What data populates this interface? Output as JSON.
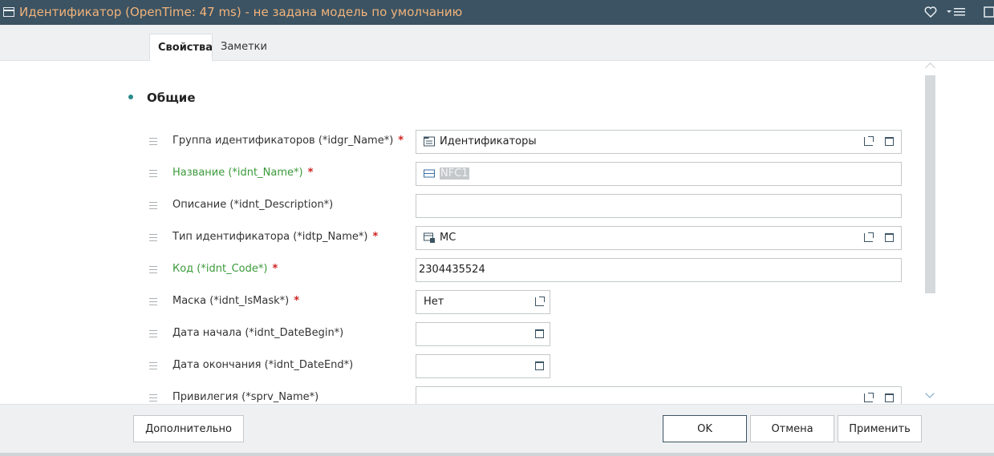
{
  "window": {
    "title": "Идентификатор (OpenTime: 47 ms) - не задана модель по умолчанию"
  },
  "tabs": [
    {
      "label": "Свойства",
      "active": true
    },
    {
      "label": "Заметки",
      "active": false
    }
  ],
  "section": {
    "title": "Общие"
  },
  "fields": [
    {
      "label": "Группа идентификаторов (*idgr_Name*)",
      "required": "*",
      "value": "Идентификаторы",
      "icon": "folder-list-icon"
    },
    {
      "label": "Название (*idnt_Name*)",
      "required": "*",
      "value": "NFC1",
      "icon": "text-field-icon"
    },
    {
      "label": "Описание (*idnt_Description*)",
      "value": ""
    },
    {
      "label": "Тип идентификатора (*idtp_Name*)",
      "required": "*",
      "value": "MC",
      "icon": "lock-list-icon"
    },
    {
      "label": "Код (*idnt_Code*)",
      "required": "*",
      "value": "2304435524"
    },
    {
      "label": "Маска (*idnt_IsMask*)",
      "required": "*",
      "value": "Нет"
    },
    {
      "label": "Дата начала (*idnt_DateBegin*)",
      "value": ""
    },
    {
      "label": "Дата окончания (*idnt_DateEnd*)",
      "value": ""
    },
    {
      "label": "Привилегия (*sprv_Name*)",
      "value": ""
    }
  ],
  "footer": {
    "more_label": "Дополнительно",
    "ok_label": "OK",
    "cancel_label": "Отмена",
    "apply_label": "Применить"
  },
  "colors": {
    "titlebar_bg": "#3b5363",
    "title_text": "#f2b37a",
    "label_green": "#3a9a3a",
    "required_red": "#d02020"
  }
}
